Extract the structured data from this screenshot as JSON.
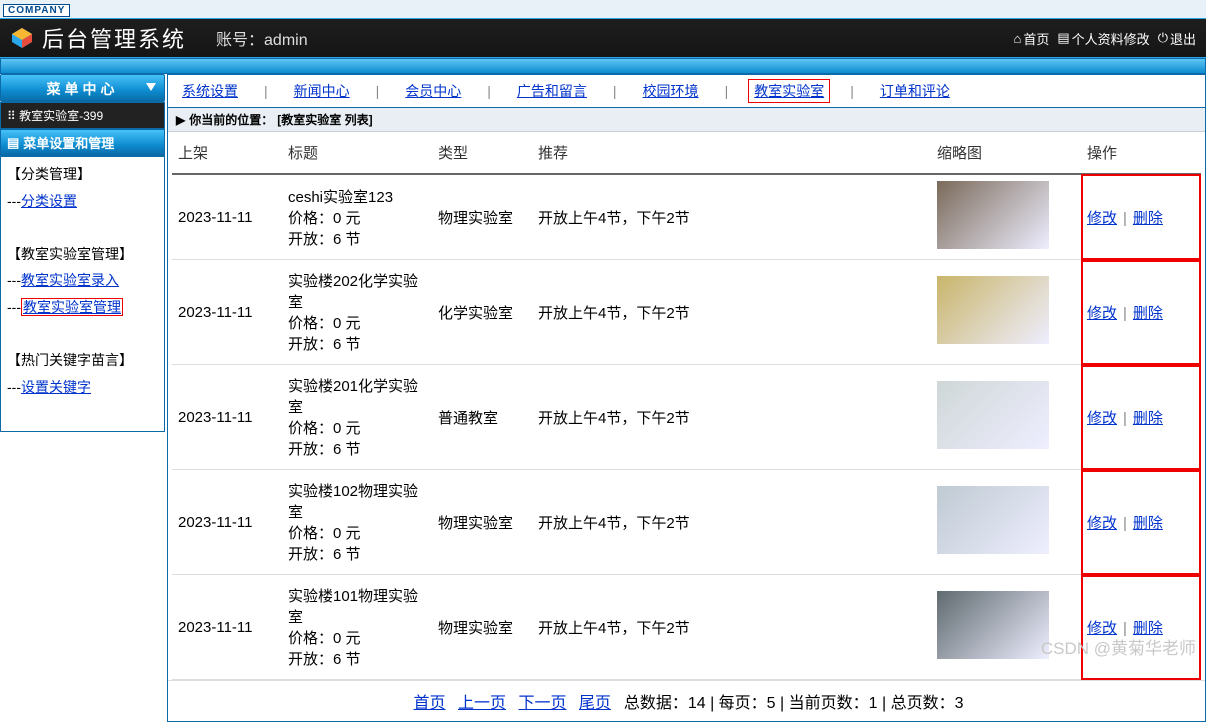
{
  "company_tag": "COMPANY",
  "header": {
    "title": "后台管理系统",
    "account_label": "账号：",
    "account_value": "admin",
    "links": {
      "home": "首页",
      "profile": "个人资料修改",
      "logout": "退出"
    }
  },
  "sidebar": {
    "menu_center": "菜单中心",
    "mini_crumb": "教室实验室-399",
    "section_header": "菜单设置和管理",
    "groups": [
      {
        "title": "【分类管理】",
        "items": [
          {
            "text": "分类设置",
            "key": "cat-set"
          }
        ]
      },
      {
        "title": "【教室实验室管理】",
        "items": [
          {
            "text": "教室实验室录入",
            "key": "lab-in"
          },
          {
            "text": "教室实验室管理",
            "key": "lab-mgr",
            "highlight": true
          }
        ]
      },
      {
        "title": "【热门关键字苗言】",
        "items": [
          {
            "text": "设置关键字",
            "key": "kw-set"
          }
        ]
      }
    ]
  },
  "nav_tabs": [
    {
      "label": "系统设置",
      "key": "sys"
    },
    {
      "label": "新闻中心",
      "key": "news"
    },
    {
      "label": "会员中心",
      "key": "member"
    },
    {
      "label": "广告和留言",
      "key": "ads"
    },
    {
      "label": "校园环境",
      "key": "campus"
    },
    {
      "label": "教室实验室",
      "key": "lab",
      "active": true
    },
    {
      "label": "订单和评论",
      "key": "order"
    }
  ],
  "location_bar": {
    "prefix": "你当前的位置：",
    "value": "[教室实验室 列表]"
  },
  "columns": {
    "c1": "上架",
    "c2": "标题",
    "c3": "类型",
    "c4": "推荐",
    "c5": "缩略图",
    "c6": "操作"
  },
  "ops": {
    "edit": "修改",
    "delete": "删除"
  },
  "rows": [
    {
      "date": "2023-11-11",
      "title": "ceshi实验室123",
      "price": "价格：0 元",
      "open": "开放：6 节",
      "type": "物理实验室",
      "rec": "开放上午4节，下午2节",
      "bg": "#7a6a5a"
    },
    {
      "date": "2023-11-11",
      "title": "实验楼202化学实验室",
      "price": "价格：0 元",
      "open": "开放：6 节",
      "type": "化学实验室",
      "rec": "开放上午4节，下午2节",
      "bg": "#c9b56a"
    },
    {
      "date": "2023-11-11",
      "title": "实验楼201化学实验室",
      "price": "价格：0 元",
      "open": "开放：6 节",
      "type": "普通教室",
      "rec": "开放上午4节，下午2节",
      "bg": "#cfd7d7"
    },
    {
      "date": "2023-11-11",
      "title": "实验楼102物理实验室",
      "price": "价格：0 元",
      "open": "开放：6 节",
      "type": "物理实验室",
      "rec": "开放上午4节，下午2节",
      "bg": "#bfcad2"
    },
    {
      "date": "2023-11-11",
      "title": "实验楼101物理实验室",
      "price": "价格：0 元",
      "open": "开放：6 节",
      "type": "物理实验室",
      "rec": "开放上午4节，下午2节",
      "bg": "#5f6a6f"
    }
  ],
  "pager": {
    "first": "首页",
    "prev": "上一页",
    "next": "下一页",
    "last": "尾页",
    "stats": "总数据：14 | 每页：5 | 当前页数：1 | 总页数：3"
  },
  "watermark": "CSDN @黄菊华老师"
}
